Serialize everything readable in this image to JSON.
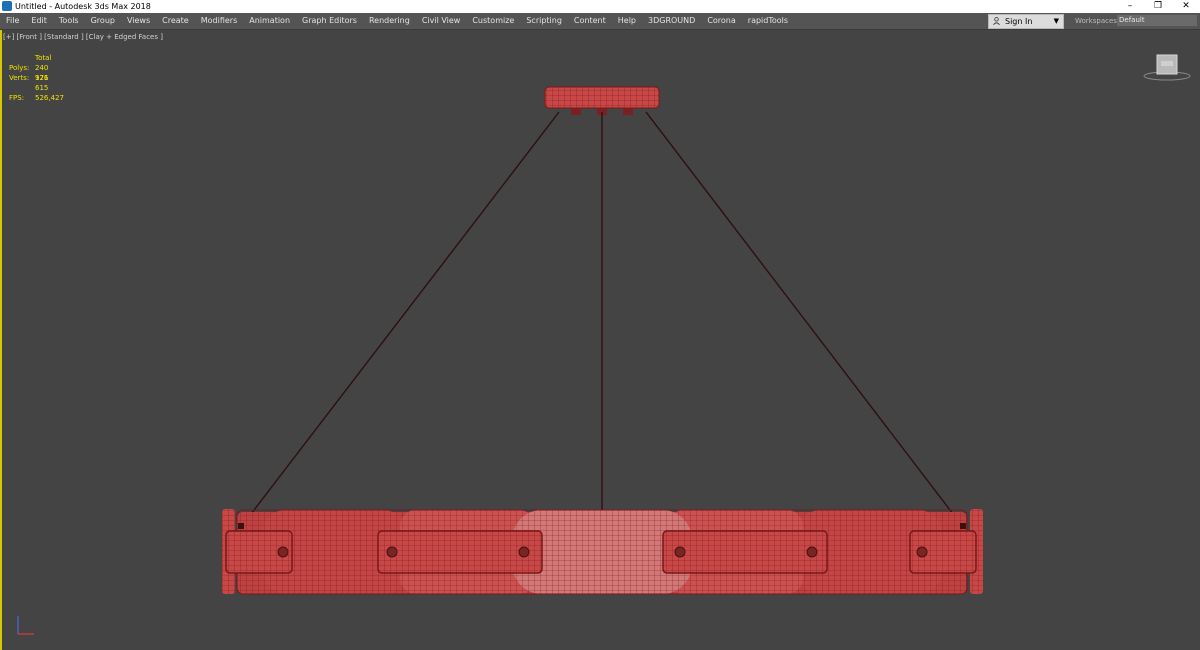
{
  "window": {
    "title": "Untitled - Autodesk 3ds Max 2018",
    "controls": [
      "–",
      "❐",
      "✕"
    ]
  },
  "menubar": {
    "items": [
      "File",
      "Edit",
      "Tools",
      "Group",
      "Views",
      "Create",
      "Modifiers",
      "Animation",
      "Graph Editors",
      "Rendering",
      "Civil View",
      "Customize",
      "Scripting",
      "Content",
      "Help",
      "3DGROUND",
      "Corona",
      "rapidTools"
    ],
    "signin": "Sign In",
    "workspaces_label": "Workspaces:",
    "workspace": "Default"
  },
  "viewport": {
    "label": "[+] [Front ] [Standard ] [Clay + Edged Faces ]",
    "stats": {
      "header": "Total",
      "polys_label": "Polys:",
      "polys": "240 976",
      "verts_label": "Verts:",
      "verts": "121 615",
      "fps_label": "FPS:",
      "fps": "526,427"
    }
  },
  "colors": {
    "background": "#444444",
    "viewport_border": "#d8c800",
    "stats_text": "#f1e300",
    "wire": "#7a1717",
    "mesh_fill": "#c84848",
    "mesh_center": "#d37878",
    "cable": "#2e0f0f"
  }
}
